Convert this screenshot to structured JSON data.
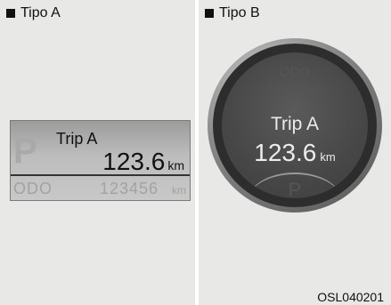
{
  "tipo_a": {
    "heading": "Tipo A",
    "lcd": {
      "p_letter": "P",
      "trip_label": "Trip A",
      "trip_value": "123.6",
      "trip_unit": "km",
      "odo_label": "ODO",
      "odo_value": "123456",
      "odo_unit": "km"
    }
  },
  "tipo_b": {
    "heading": "Tipo B",
    "display": {
      "odo_label": "ODO",
      "odo_value": "123456",
      "odo_unit": "km",
      "trip_label": "Trip A",
      "trip_value": "123.6",
      "trip_unit": "km",
      "p_letter": "P"
    }
  },
  "figure_code": "OSL040201"
}
